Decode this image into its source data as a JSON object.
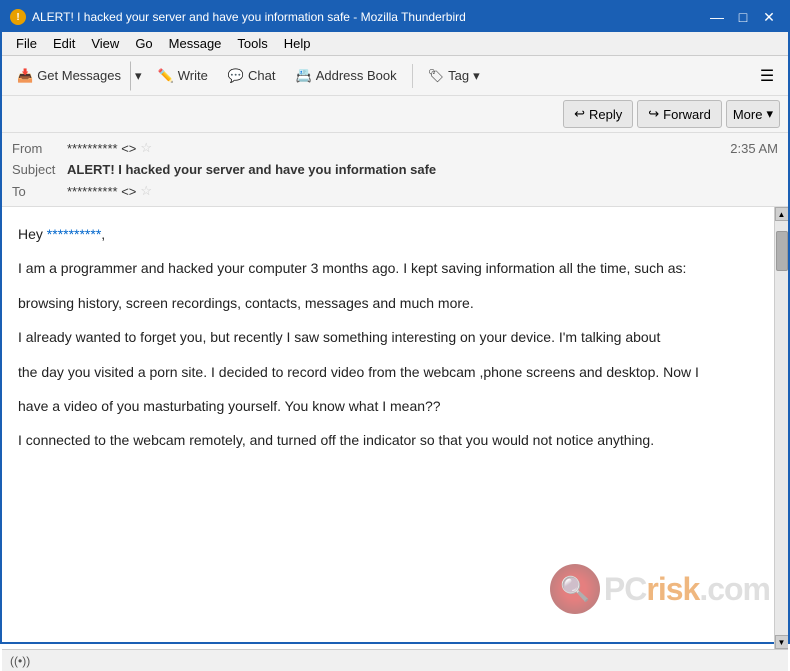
{
  "titlebar": {
    "icon": "!",
    "title": "ALERT! I hacked your server and have you information safe - Mozilla Thunderbird",
    "minimize": "—",
    "maximize": "□",
    "close": "✕"
  },
  "menubar": {
    "items": [
      "File",
      "Edit",
      "View",
      "Go",
      "Message",
      "Tools",
      "Help"
    ]
  },
  "toolbar": {
    "get_messages": "Get Messages",
    "write": "Write",
    "chat": "Chat",
    "address_book": "Address Book",
    "tag": "Tag",
    "tag_arrow": "▾"
  },
  "email_actions": {
    "reply": "Reply",
    "forward": "Forward",
    "more": "More",
    "more_arrow": "▾"
  },
  "email_header": {
    "from_label": "From",
    "from_value": "********** <>",
    "subject_label": "Subject",
    "subject_value": "ALERT! I hacked your server and have you information safe",
    "to_label": "To",
    "to_value": "********** <>",
    "timestamp": "2:35 AM"
  },
  "email_body": {
    "greeting": "Hey ",
    "name": "**********",
    "greeting_end": ",",
    "para1": "I am a programmer and hacked your computer 3 months ago. I kept saving information all the time, such as:",
    "para2": "browsing history, screen recordings, contacts, messages and much more.",
    "para3": "I already wanted to forget you, but recently I saw something interesting on your device. I'm talking about",
    "para4": "the day you visited a porn site. I decided to record video from the webcam ,phone screens and desktop. Now I",
    "para5": "have a video of you masturbating yourself. You know what I mean??",
    "para6": "I connected to the webcam remotely, and turned off the indicator so that you would not notice anything."
  },
  "statusbar": {
    "wifi": "((•))"
  }
}
